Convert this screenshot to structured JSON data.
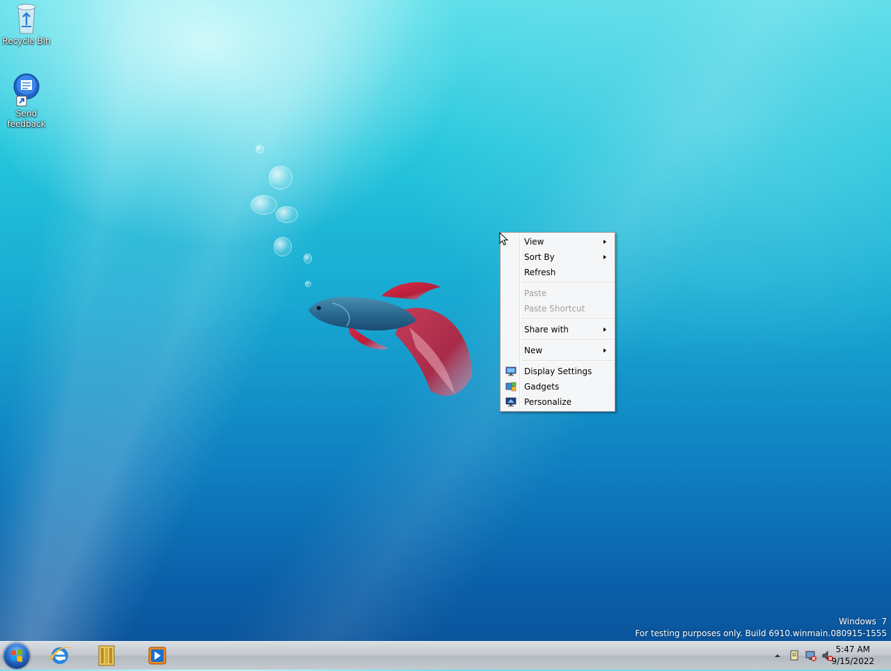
{
  "desktop": {
    "icons": [
      {
        "label": "Recycle Bin",
        "icon": "recycle-bin-icon"
      },
      {
        "label_line1": "Send",
        "label_line2": "feedback",
        "icon": "send-feedback-icon"
      }
    ]
  },
  "context_menu": {
    "items": [
      {
        "label": "View",
        "submenu": true,
        "enabled": true
      },
      {
        "label": "Sort By",
        "submenu": true,
        "enabled": true
      },
      {
        "label": "Refresh",
        "submenu": false,
        "enabled": true
      },
      {
        "label": "Paste",
        "submenu": false,
        "enabled": false
      },
      {
        "label": "Paste Shortcut",
        "submenu": false,
        "enabled": false
      },
      {
        "label": "Share with",
        "submenu": true,
        "enabled": true
      },
      {
        "label": "New",
        "submenu": true,
        "enabled": true
      },
      {
        "label": "Display Settings",
        "icon": "display-settings-icon",
        "enabled": true
      },
      {
        "label": "Gadgets",
        "icon": "gadgets-icon",
        "enabled": true
      },
      {
        "label": "Personalize",
        "icon": "personalize-icon",
        "enabled": true
      }
    ]
  },
  "watermark": {
    "line1": "Windows  7",
    "line2": "For testing purposes only. Build 6910.winmain.080915-1555"
  },
  "taskbar": {
    "start_icon": "windows-start-orb-icon",
    "pinned": [
      "internet-explorer-icon",
      "windows-explorer-icon",
      "media-player-icon"
    ],
    "tray_icons": [
      "show-hidden-icons-arrow-icon",
      "action-center-icon",
      "network-icon",
      "volume-muted-icon"
    ],
    "clock": {
      "time": "5:47 AM",
      "date": "9/15/2022"
    }
  },
  "colors": {
    "menu_bg": "#f5f6f7",
    "menu_border": "#979797",
    "disabled_text": "#a0a0a0",
    "taskbar_bg": "#c3c8ce"
  }
}
